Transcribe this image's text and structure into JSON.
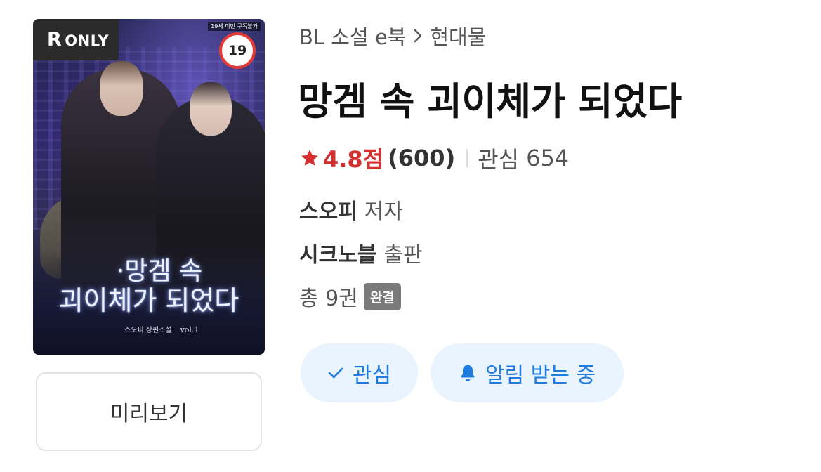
{
  "cover": {
    "badge_r": "R",
    "badge_only": "ONLY",
    "adult_note": "19세 미만 구독불가",
    "age_rating": "19",
    "title_line1": "·망겜 속",
    "title_line2": "괴이체가 되었다",
    "byline": "스오피 장편소설",
    "volume": "vol.1"
  },
  "preview_button": {
    "label": "미리보기"
  },
  "breadcrumb": {
    "category": "BL 소설 e북",
    "separator_icon": "chevron-right-icon",
    "subcategory": "현대물"
  },
  "book": {
    "title": "망겜 속 괴이체가 되었다",
    "rating_score": "4.8점",
    "rating_count": "(600)",
    "interest_label": "관심",
    "interest_count": "654",
    "author_name": "스오피",
    "author_role": "저자",
    "publisher_name": "시크노블",
    "publisher_role": "출판",
    "volumes": "총 9권",
    "status_badge": "완결"
  },
  "actions": {
    "interest_label": "관심",
    "alert_label": "알림 받는 중"
  },
  "colors": {
    "rating_red": "#d32f2f",
    "action_blue": "#1e7be0",
    "action_bg": "#eaf4ff",
    "age_badge_border": "#e53935",
    "complete_badge_bg": "#7a7a7a"
  }
}
